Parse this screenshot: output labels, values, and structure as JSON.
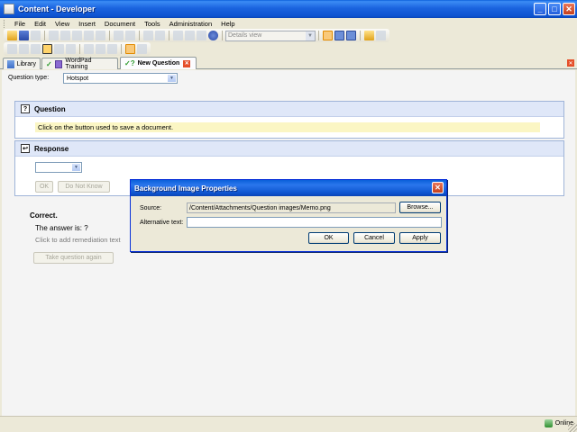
{
  "window": {
    "title": "Content - Developer",
    "minimize": "_",
    "maximize": "□",
    "close": "✕"
  },
  "menu": [
    "File",
    "Edit",
    "View",
    "Insert",
    "Document",
    "Tools",
    "Administration",
    "Help"
  ],
  "toolbar": {
    "view_select": "Details view",
    "view_arrow": "▼"
  },
  "tabs": [
    {
      "label": "Library",
      "icon": "library-icon"
    },
    {
      "label": "WordPad Training",
      "icon": "checkmark-icon"
    },
    {
      "label": "New Question",
      "icon": "question-icon",
      "close": "✕"
    }
  ],
  "tabstrip_close": "✕",
  "editor": {
    "question_type_label": "Question type:",
    "question_type_value": "Hotspot",
    "question_header": "Question",
    "question_icon_glyph": "?",
    "question_text": "Click on the button used to save a document.",
    "response_header": "Response",
    "response_icon_glyph": "↩",
    "response_select_value": "",
    "ok_label": "OK",
    "dont_know_label": "Do Not Know",
    "correct_label": "Correct.",
    "answer_text": "The answer is: ?",
    "remediation_text": "Click to add remediation text",
    "take_again_label": "Take question again",
    "select_arrow": "▼"
  },
  "dialog": {
    "title": "Background Image Properties",
    "close": "✕",
    "source_label": "Source:",
    "source_value": "/Content/Attachments/Question images/Memo.png",
    "browse_label": "Browse...",
    "alt_label": "Alternative text:",
    "alt_value": "",
    "ok_label": "OK",
    "cancel_label": "Cancel",
    "apply_label": "Apply"
  },
  "status": {
    "online": "Online"
  }
}
